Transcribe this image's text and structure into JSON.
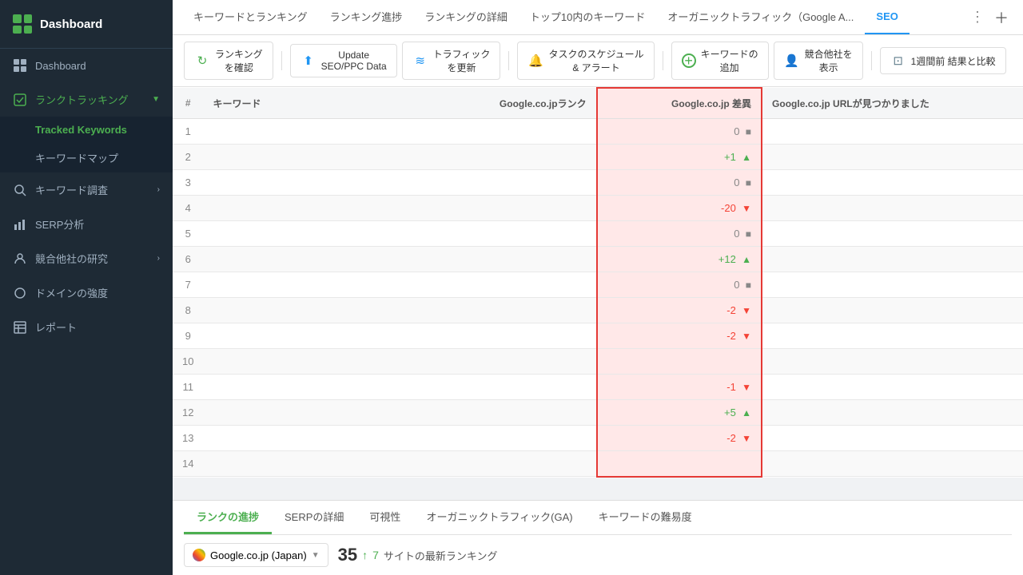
{
  "sidebar": {
    "logo": "Dashboard",
    "items": [
      {
        "id": "dashboard",
        "label": "Dashboard",
        "icon": "grid"
      },
      {
        "id": "rank-tracking",
        "label": "ランクトラッキング",
        "icon": "check-square",
        "active": true,
        "hasChevron": true
      },
      {
        "id": "tracked-keywords",
        "label": "Tracked Keywords",
        "sub": true,
        "active": true
      },
      {
        "id": "keyword-map",
        "label": "キーワードマップ",
        "sub": true
      },
      {
        "id": "keyword-research",
        "label": "キーワード調査",
        "icon": "search",
        "hasChevron": true
      },
      {
        "id": "serp-analysis",
        "label": "SERP分析",
        "icon": "bar-chart"
      },
      {
        "id": "competitor-research",
        "label": "競合他社の研究",
        "icon": "user",
        "hasChevron": true
      },
      {
        "id": "domain-strength",
        "label": "ドメインの強度",
        "icon": "circle"
      },
      {
        "id": "reports",
        "label": "レポート",
        "icon": "table"
      }
    ]
  },
  "top_tabs": [
    {
      "label": "キーワードとランキング"
    },
    {
      "label": "ランキング進捗"
    },
    {
      "label": "ランキングの詳細"
    },
    {
      "label": "トップ10内のキーワード"
    },
    {
      "label": "オーガニックトラフィック（Google A..."
    },
    {
      "label": "SEO",
      "active": true
    }
  ],
  "toolbar": {
    "buttons": [
      {
        "id": "check-ranking",
        "label": "ランキング\nを確認",
        "icon": "↻",
        "color": "green"
      },
      {
        "id": "update-seoppc",
        "label": "Update\nSEO/PPC Data",
        "icon": "↑",
        "color": "blue"
      },
      {
        "id": "update-traffic",
        "label": "トラフィック\nを更新",
        "icon": "≈",
        "color": "blue"
      },
      {
        "id": "schedule-alert",
        "label": "タスクのスケジュール\n& アラート",
        "icon": "🔔",
        "color": "orange"
      },
      {
        "id": "add-keyword",
        "label": "キーワードの\n追加",
        "icon": "+",
        "color": "green"
      },
      {
        "id": "show-competitor",
        "label": "競合他社を\n表示",
        "icon": "👤",
        "color": "teal"
      },
      {
        "id": "compare-week",
        "label": "1週間前 結果と比較",
        "icon": "⊞",
        "color": "gray"
      }
    ]
  },
  "table": {
    "columns": [
      "#",
      "キーワード",
      "Google.co.jpランク",
      "Google.co.jp 差異",
      "Google.co.jp URLが見つかりました"
    ],
    "rows": [
      {
        "num": 1,
        "keyword": "",
        "rank": "",
        "diff": "0",
        "diff_type": "neutral",
        "url": ""
      },
      {
        "num": 2,
        "keyword": "",
        "rank": "",
        "diff": "+1",
        "diff_type": "positive",
        "url": ""
      },
      {
        "num": 3,
        "keyword": "",
        "rank": "",
        "diff": "0",
        "diff_type": "neutral",
        "url": ""
      },
      {
        "num": 4,
        "keyword": "",
        "rank": "",
        "diff": "-20",
        "diff_type": "negative",
        "url": ""
      },
      {
        "num": 5,
        "keyword": "",
        "rank": "",
        "diff": "0",
        "diff_type": "neutral",
        "url": ""
      },
      {
        "num": 6,
        "keyword": "",
        "rank": "",
        "diff": "+12",
        "diff_type": "positive",
        "url": ""
      },
      {
        "num": 7,
        "keyword": "",
        "rank": "",
        "diff": "0",
        "diff_type": "neutral",
        "url": ""
      },
      {
        "num": 8,
        "keyword": "",
        "rank": "",
        "diff": "-2",
        "diff_type": "negative",
        "url": ""
      },
      {
        "num": 9,
        "keyword": "",
        "rank": "",
        "diff": "-2",
        "diff_type": "negative",
        "url": ""
      },
      {
        "num": 10,
        "keyword": "",
        "rank": "",
        "diff": "",
        "diff_type": "none",
        "url": ""
      },
      {
        "num": 11,
        "keyword": "",
        "rank": "",
        "diff": "-1",
        "diff_type": "negative",
        "url": ""
      },
      {
        "num": 12,
        "keyword": "",
        "rank": "",
        "diff": "+5",
        "diff_type": "positive",
        "url": ""
      },
      {
        "num": 13,
        "keyword": "",
        "rank": "",
        "diff": "-2",
        "diff_type": "negative",
        "url": ""
      },
      {
        "num": 14,
        "keyword": "",
        "rank": "",
        "diff": "",
        "diff_type": "none",
        "url": ""
      }
    ]
  },
  "bottom": {
    "tabs": [
      {
        "label": "ランクの進捗",
        "active": true
      },
      {
        "label": "SERPの詳細"
      },
      {
        "label": "可視性"
      },
      {
        "label": "オーガニックトラフィック(GA)"
      },
      {
        "label": "キーワードの難易度"
      }
    ],
    "selector_label": "Google.co.jp (Japan)",
    "ranking_count": "35",
    "ranking_up": "7",
    "ranking_label": "サイトの最新ランキング"
  }
}
